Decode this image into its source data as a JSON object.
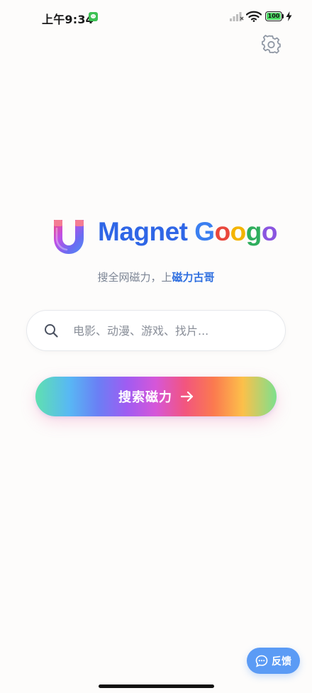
{
  "status_bar": {
    "time": "上午9:34",
    "battery_level": "100",
    "icons": [
      "wechat-icon",
      "signal-icon",
      "wifi-icon",
      "battery-icon",
      "charging-bolt-icon"
    ]
  },
  "header": {
    "settings_icon": "gear-icon"
  },
  "brand": {
    "logo_icon": "magnet-u-icon",
    "name_word1": "Magnet",
    "name_word2_letters": [
      "G",
      "o",
      "o",
      "g",
      "o"
    ]
  },
  "tagline": {
    "prefix": "搜全网磁力，上",
    "highlight": "磁力古哥"
  },
  "search": {
    "placeholder": "电影、动漫、游戏、找片...",
    "value": "",
    "icon": "search-icon"
  },
  "search_button": {
    "label": "搜索磁力",
    "icon": "arrow-right-icon"
  },
  "feedback": {
    "label": "反馈",
    "icon": "chat-bubble-icon"
  },
  "colors": {
    "accent_blue": "#2f66e6",
    "feedback_blue": "#5b9bf5",
    "tagline_gray": "#7b8494"
  }
}
